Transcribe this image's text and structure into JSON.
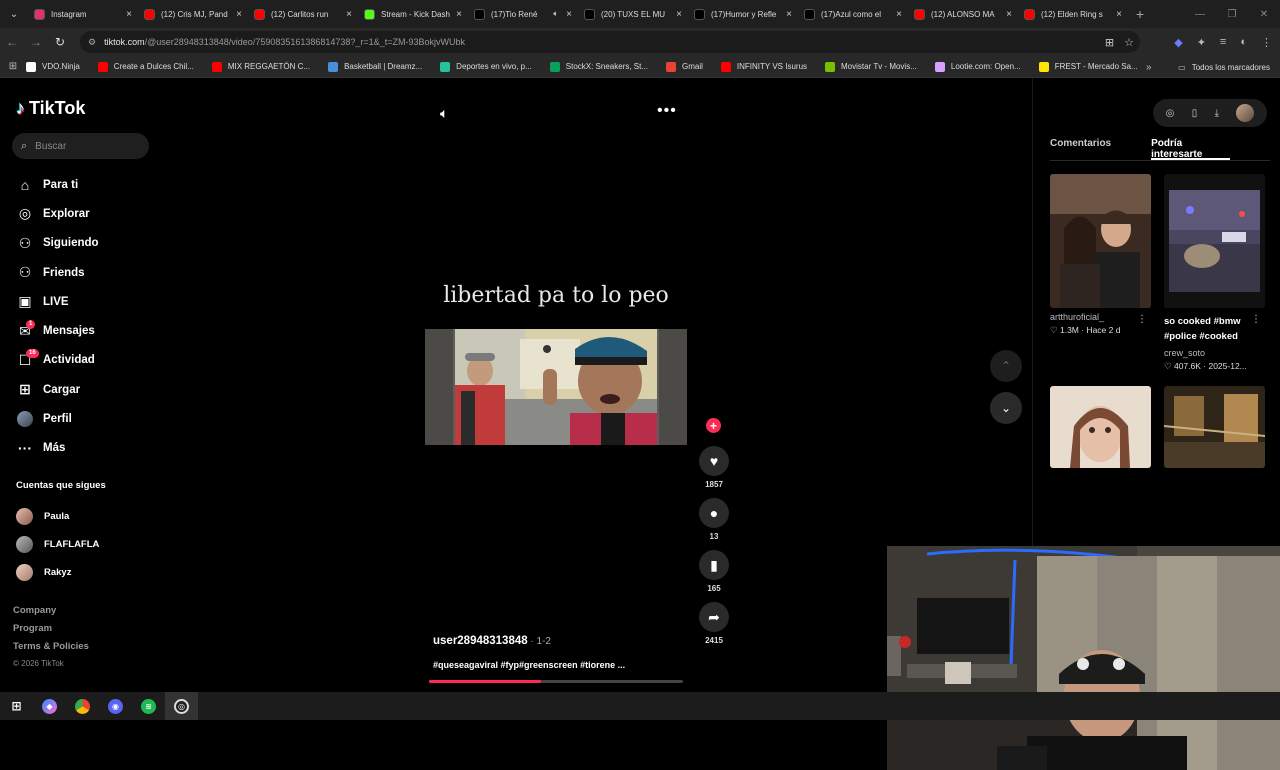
{
  "browser": {
    "tabs": [
      {
        "title": "Instagram",
        "favicon": "instagram-icon",
        "color": "#e1306c"
      },
      {
        "title": "(12) Cris MJ, Pand",
        "favicon": "youtube-icon",
        "color": "#ff0000"
      },
      {
        "title": "(12) Carlitos run",
        "favicon": "youtube-icon",
        "color": "#ff0000"
      },
      {
        "title": "Stream - Kick Dash",
        "favicon": "kick-icon",
        "color": "#53fc18"
      },
      {
        "title": "(17)Tio René",
        "favicon": "tiktok-icon",
        "color": "#000000",
        "audio": true
      },
      {
        "title": "(20) TUXS EL MU",
        "favicon": "x-icon",
        "color": "#000000"
      },
      {
        "title": "(17)Humor y Refle",
        "favicon": "tiktok-icon",
        "color": "#000000"
      },
      {
        "title": "(17)Azul como el",
        "favicon": "tiktok-icon",
        "color": "#000000"
      },
      {
        "title": "(12) ALONSO MA",
        "favicon": "youtube-icon",
        "color": "#ff0000"
      },
      {
        "title": "(12) Elden Ring s",
        "favicon": "youtube-icon",
        "color": "#ff0000"
      }
    ],
    "url_host": "tiktok.com",
    "url_path": "/@user28948313848/video/7590835161386814738?_r=1&_t=ZM-93BokjvWUbk",
    "bookmarks": [
      {
        "label": "VDO.Ninja",
        "color": "#ffffff"
      },
      {
        "label": "Create a Dulces Chil...",
        "color": "#ff0000"
      },
      {
        "label": "MIX REGGAETÓN C...",
        "color": "#ff0000"
      },
      {
        "label": "Basketball | Dreamz...",
        "color": "#4a90d9"
      },
      {
        "label": "Deportes en vivo, p...",
        "color": "#25c2a0"
      },
      {
        "label": "StockX: Sneakers, St...",
        "color": "#08a05c"
      },
      {
        "label": "Gmail",
        "color": "#ea4335"
      },
      {
        "label": "INFINITY VS Isurus",
        "color": "#ff0000"
      },
      {
        "label": "Movistar Tv - Movis...",
        "color": "#79c000"
      },
      {
        "label": "Lootie.com: Open...",
        "color": "#d9a0ff"
      },
      {
        "label": "FREST - Mercado Sa...",
        "color": "#ffe600"
      }
    ],
    "bookmarks_all": "Todos los marcadores"
  },
  "tiktok": {
    "logo": "TikTok",
    "search_placeholder": "Buscar",
    "nav": [
      {
        "label": "Para ti",
        "icon": "home-icon"
      },
      {
        "label": "Explorar",
        "icon": "compass-icon"
      },
      {
        "label": "Siguiendo",
        "icon": "following-icon"
      },
      {
        "label": "Friends",
        "icon": "friends-icon"
      },
      {
        "label": "LIVE",
        "icon": "live-icon"
      },
      {
        "label": "Mensajes",
        "icon": "messages-icon",
        "badge": "1"
      },
      {
        "label": "Actividad",
        "icon": "activity-icon",
        "badge": "16"
      },
      {
        "label": "Cargar",
        "icon": "upload-icon"
      },
      {
        "label": "Perfil",
        "icon": "profile-avatar"
      },
      {
        "label": "Más",
        "icon": "more-icon"
      }
    ],
    "following_title": "Cuentas que sigues",
    "following": [
      "Paula",
      "FLAFLAFLA",
      "Rakyz"
    ],
    "footer": [
      "Company",
      "Program",
      "Terms & Policies"
    ],
    "copyright": "© 2026 TikTok",
    "video": {
      "caption_overlay": "libertad pa to lo peo",
      "username": "user28948313848",
      "date": " · 1-2",
      "hashtags": "#queseagaviral #fyp#greenscreen #tiorene ...",
      "progress_fraction": 0.44,
      "likes": "1857",
      "comments": "13",
      "saves": "165",
      "shares": "2415"
    },
    "right_panel": {
      "tabs": [
        "Comentarios",
        "Podría interesarte"
      ],
      "active_tab": 1,
      "cards": [
        {
          "title": "",
          "author": "artthuroficial_",
          "stats": "♡ 1.3M · Hace 2 d"
        },
        {
          "title": "so cooked #bmw #police #cooked",
          "author": "crew_soto",
          "stats": "♡ 407.6K · 2025-12..."
        }
      ]
    }
  },
  "colors": {
    "accent": "#fe2c55",
    "background": "#000000"
  }
}
